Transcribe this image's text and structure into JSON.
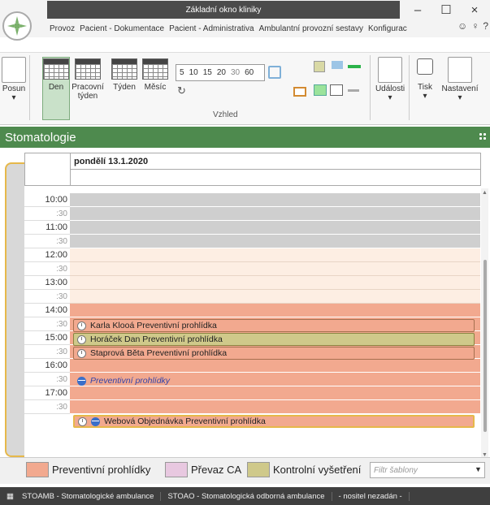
{
  "window": {
    "title": "Základní okno kliniky",
    "min": "–",
    "max": "☐",
    "close": "×"
  },
  "menu": [
    "Provoz",
    "Pacient - Dokumentace",
    "Pacient - Administrativa",
    "Ambulantní provozní sestavy",
    "Konfigurac"
  ],
  "menu_icons": [
    "☺",
    "♀",
    "?"
  ],
  "ribbon": {
    "posun": "Posun",
    "den": "Den",
    "pracovni": "Pracovní týden",
    "tyden": "Týden",
    "mesic": "Měsíc",
    "zoom": [
      "5",
      "10",
      "15",
      "20",
      "30",
      "60"
    ],
    "group_label": "Vzhled",
    "udalosti": "Události",
    "tisk": "Tisk",
    "nastaveni": "Nastavení"
  },
  "department": "Stomatologie",
  "day_header": "pondělí 13.1.2020",
  "times": [
    "10:00",
    ":30",
    "11:00",
    ":30",
    "12:00",
    ":30",
    "13:00",
    ":30",
    "14:00",
    ":30",
    "15:00",
    ":30",
    "16:00",
    ":30",
    "17:00",
    ":30"
  ],
  "appointments": [
    {
      "name": "Karla Klooá",
      "type": "Preventivní prohlídka"
    },
    {
      "name": "Horáček Dan",
      "type": "Preventivní prohlídka"
    },
    {
      "name": "Staprová Běta",
      "type": "Preventivní prohlídka"
    },
    {
      "name": "Preventivní prohlídky"
    },
    {
      "name": "Webová Objednávka",
      "type": "Preventivní prohlídka"
    }
  ],
  "legend": [
    {
      "label": "Preventivní prohlídky",
      "color": "#f2a98f"
    },
    {
      "label": "Převaz CA",
      "color": "#e8c8e0"
    },
    {
      "label": "Kontrolní vyšetření",
      "color": "#cfc98a"
    }
  ],
  "filter_placeholder": "Filtr šablony",
  "status": [
    "STOAMB - Stomatologické ambulance",
    "STOAO - Stomatologická odborná ambulance",
    "- nositel nezadán -"
  ],
  "colors": {
    "accent": "#4e8a4e",
    "gray_block": "#cfcfcf",
    "open_slot": "#fdeee3",
    "preventive": "#f2a98f",
    "control": "#cfc98a"
  }
}
